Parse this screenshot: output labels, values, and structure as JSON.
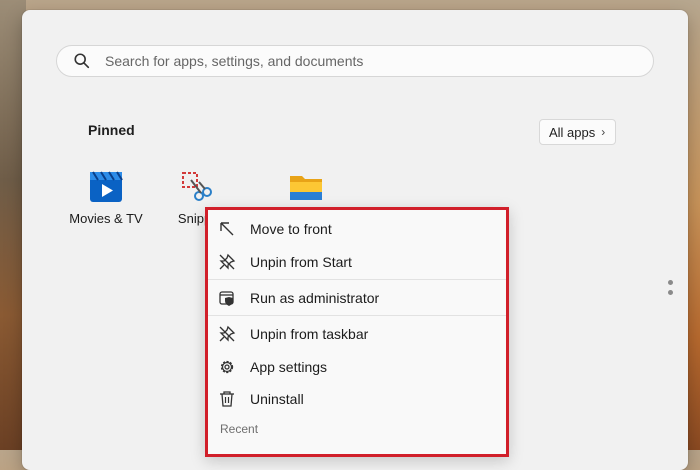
{
  "search": {
    "placeholder": "Search for apps, settings, and documents",
    "icon": "search-icon"
  },
  "pinned": {
    "title": "Pinned",
    "all_apps_label": "All apps",
    "apps": [
      {
        "label": "Movies & TV",
        "icon": "movies-tv-icon"
      },
      {
        "label": "Snippi",
        "icon": "snipping-tool-icon"
      },
      {
        "label": "",
        "icon": "file-explorer-icon"
      }
    ]
  },
  "context_menu": {
    "items": [
      {
        "label": "Move to front",
        "icon": "arrow-up-left-icon"
      },
      {
        "label": "Unpin from Start",
        "icon": "unpin-icon"
      },
      {
        "label": "Run as administrator",
        "icon": "shield-window-icon"
      },
      {
        "label": "Unpin from taskbar",
        "icon": "unpin-icon"
      },
      {
        "label": "App settings",
        "icon": "gear-icon"
      },
      {
        "label": "Uninstall",
        "icon": "trash-icon"
      }
    ],
    "section_label": "Recent"
  },
  "colors": {
    "highlight_border": "#d11f2a",
    "menu_bg": "#f9f9f9",
    "start_bg": "#f1f1f1"
  }
}
